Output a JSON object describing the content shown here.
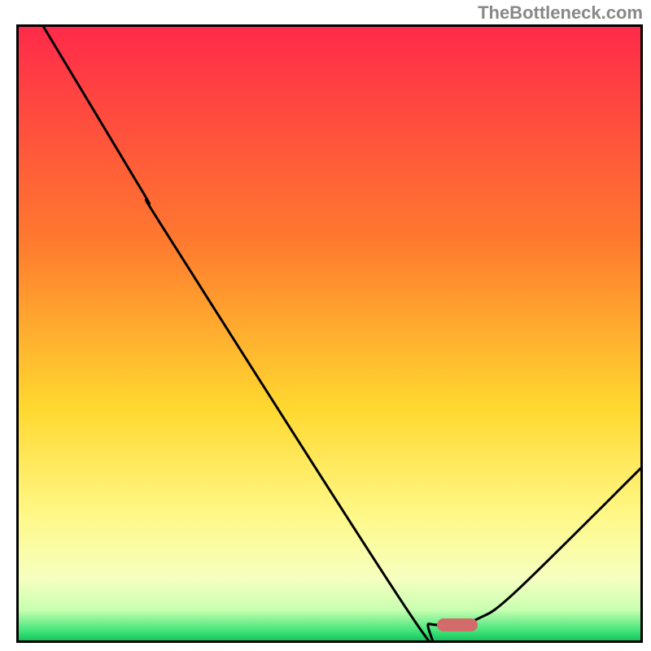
{
  "watermark": "TheBottleneck.com",
  "chart_data": {
    "type": "line",
    "title": "",
    "xlabel": "",
    "ylabel": "",
    "xlim": [
      0,
      100
    ],
    "ylim": [
      0,
      100
    ],
    "gradient_stops": [
      {
        "offset": 0,
        "color": "#ff2a4a"
      },
      {
        "offset": 35,
        "color": "#ff7a2f"
      },
      {
        "offset": 62,
        "color": "#ffd82f"
      },
      {
        "offset": 80,
        "color": "#fff98a"
      },
      {
        "offset": 90,
        "color": "#f5ffc0"
      },
      {
        "offset": 95,
        "color": "#c9ffb0"
      },
      {
        "offset": 98.5,
        "color": "#3fe47a"
      },
      {
        "offset": 100,
        "color": "#18c45c"
      }
    ],
    "curve": [
      {
        "x": 4.0,
        "y": 100.0
      },
      {
        "x": 20.0,
        "y": 73.0
      },
      {
        "x": 24.0,
        "y": 66.0
      },
      {
        "x": 63.0,
        "y": 4.2
      },
      {
        "x": 66.0,
        "y": 2.7
      },
      {
        "x": 70.0,
        "y": 2.6
      },
      {
        "x": 74.0,
        "y": 3.6
      },
      {
        "x": 80.0,
        "y": 8.0
      },
      {
        "x": 100.0,
        "y": 28.0
      }
    ],
    "marker": {
      "x": 70.5,
      "y": 2.5
    }
  }
}
